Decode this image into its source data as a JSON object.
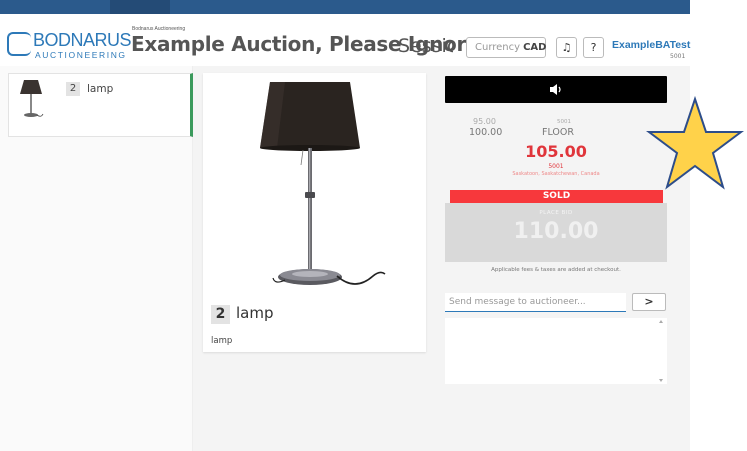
{
  "header": {
    "logo_name": "BODNARUS",
    "logo_sub": "AUCTIONEERING",
    "company_small": "Bodnarus Auctioneering",
    "auction_title": "Example Auction, Please Ignore",
    "session_label": "Session",
    "currency_label": "Currency",
    "currency_value": "CAD",
    "music_icon": "♫",
    "help_icon": "?",
    "user_name": "ExampleBATest",
    "user_id": "5001"
  },
  "sidebar": {
    "lots": [
      {
        "number": "2",
        "name": "lamp"
      }
    ]
  },
  "lot": {
    "number": "2",
    "name": "lamp",
    "description": "lamp"
  },
  "bidding": {
    "history": [
      {
        "amount": "95.00",
        "bidder": "5001"
      },
      {
        "amount": "100.00",
        "bidder": "FLOOR"
      }
    ],
    "current_bid": "105.00",
    "current_bidder": "5001",
    "current_location": "Saskatoon, Saskatchewan, Canada",
    "status": "SOLD",
    "place_bid_label": "PLACE BID",
    "place_bid_amount": "110.00",
    "fees_note": "Applicable fees & taxes are added at checkout."
  },
  "chat": {
    "placeholder": "Send message to auctioneer...",
    "send_label": ">"
  },
  "colors": {
    "accent": "#2d79b8",
    "bid_red": "#e0353b",
    "sold_red": "#f7383c",
    "selected_green": "#3b9a5c",
    "star_fill": "#ffd24a"
  }
}
